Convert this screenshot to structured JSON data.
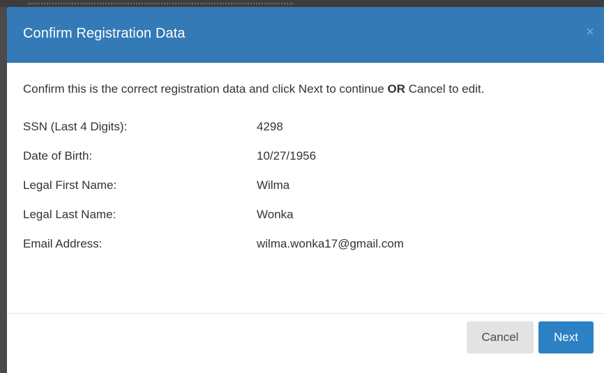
{
  "dialog": {
    "title": "Confirm Registration Data",
    "close_glyph": "×"
  },
  "intro": {
    "part1": "Confirm this is the correct registration data and click Next to continue ",
    "emphasis": "OR",
    "part2": " Cancel to edit."
  },
  "fields": [
    {
      "label": "SSN (Last 4 Digits):",
      "value": "4298"
    },
    {
      "label": "Date of Birth:",
      "value": "10/27/1956"
    },
    {
      "label": "Legal First Name:",
      "value": "Wilma"
    },
    {
      "label": "Legal Last Name:",
      "value": "Wonka"
    },
    {
      "label": "Email Address:",
      "value": "wilma.wonka17@gmail.com"
    }
  ],
  "footer": {
    "cancel_label": "Cancel",
    "next_label": "Next"
  },
  "colors": {
    "header_bg": "#337ab7",
    "next_button": "#2c81c5",
    "cancel_button": "#e3e3e3"
  }
}
